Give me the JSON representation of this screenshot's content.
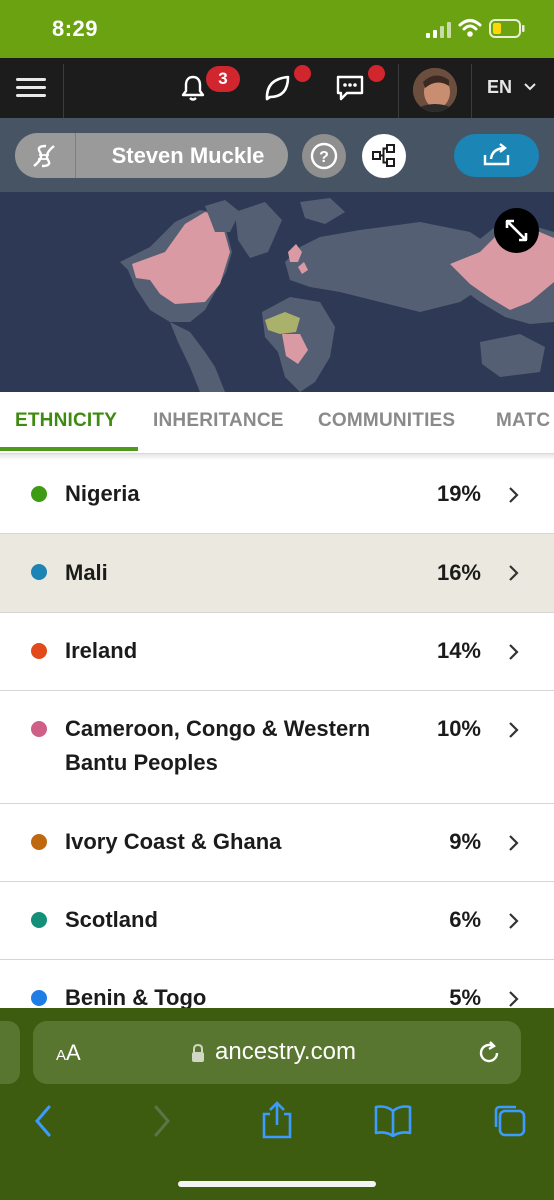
{
  "status_bar": {
    "time": "8:29"
  },
  "header": {
    "notifications_count": "3",
    "language": "EN"
  },
  "toolbar": {
    "person_name": "Steven Muckle",
    "help_glyph": "?"
  },
  "tabs": [
    {
      "label": "ETHNICITY",
      "active": true
    },
    {
      "label": "INHERITANCE",
      "active": false
    },
    {
      "label": "COMMUNITIES",
      "active": false
    },
    {
      "label": "MATC",
      "active": false
    }
  ],
  "ethnicities": [
    {
      "name": "Nigeria",
      "percent": "19%",
      "color": "#3f9a14",
      "selected": false
    },
    {
      "name": "Mali",
      "percent": "16%",
      "color": "#1d84b5",
      "selected": true
    },
    {
      "name": "Ireland",
      "percent": "14%",
      "color": "#e24a1b",
      "selected": false
    },
    {
      "name_line1": "Cameroon, Congo & Western",
      "name_line2": "Bantu Peoples",
      "percent": "10%",
      "color": "#cf5f86",
      "selected": false
    },
    {
      "name": "Ivory Coast & Ghana",
      "percent": "9%",
      "color": "#c0680f",
      "selected": false
    },
    {
      "name": "Scotland",
      "percent": "6%",
      "color": "#13907a",
      "selected": false
    },
    {
      "name": "Benin & Togo",
      "percent": "5%",
      "color": "#1f7ee6",
      "selected": false
    }
  ],
  "browser": {
    "text_size_label_small": "A",
    "text_size_label_large": "A",
    "url": "ancestry.com"
  },
  "colors": {
    "status_bar_bg": "#6aa211",
    "brand_green": "#3f8b12",
    "share_blue": "#1b85b5",
    "safari_bg": "#3d5c10"
  }
}
